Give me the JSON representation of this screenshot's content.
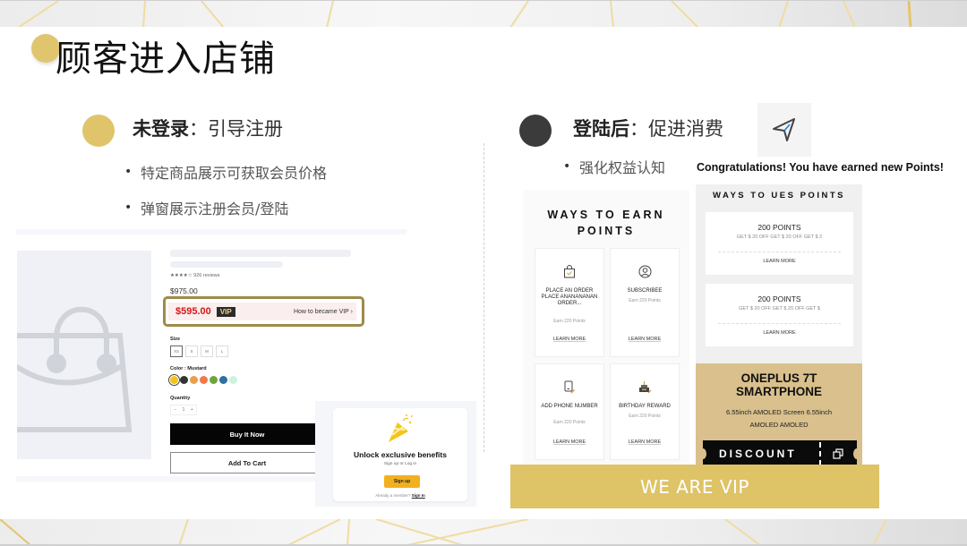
{
  "slide": {
    "title": "顾客进入店铺",
    "accent_gold": "#dfc46b",
    "accent_dark": "#3b3b3b"
  },
  "left_section": {
    "heading_bold": "未登录",
    "heading_rest": "：引导注册",
    "bullets": [
      "特定商品展示可获取会员价格",
      "弹窗展示注册会员/登陆"
    ],
    "product": {
      "image_icon": "shopping-bag-icon",
      "reviews": "★★★★☆ 926 reviews",
      "original_price": "$975.00",
      "vip_price": "$595.00",
      "vip_tag": "VIP",
      "vip_link": "How to became VIP  ›",
      "size_label": "Size",
      "sizes": [
        "XS",
        "S",
        "M",
        "L"
      ],
      "selected_size": "XS",
      "color_label": "Color : Mustard",
      "colors": [
        "#f2c31b",
        "#333333",
        "#e8a04f",
        "#f1784b",
        "#6da53a",
        "#2f6fa3",
        "#cdf2dc"
      ],
      "selected_color": "Mustard",
      "quantity_label": "Quantity",
      "quantity": "1",
      "qty_minus": "−",
      "qty_plus": "+",
      "buy_now": "Buy It Now",
      "add_to_cart": "Add To Cart"
    },
    "popup": {
      "icon": "party-popper-icon",
      "title": "Unlock exclusive benefits",
      "subtitle": "Sign up or Log in",
      "signup_button": "Sign up",
      "member_text": "Already a member? ",
      "signin_link": "Sign In"
    }
  },
  "right_section": {
    "heading_bold": "登陆后",
    "heading_rest": "：促进消费",
    "bullets": [
      "强化权益认知"
    ],
    "send_icon": "send-icon",
    "congrats": "Congratulations! You have earned new Points!",
    "earn_panel": {
      "title_line1": "WAYS TO EARN",
      "title_line2": "POINTS",
      "cards": [
        {
          "icon": "shopping-bag-icon",
          "name": "PLACE AN ORDER PLACE ANANANANAN ORDER...",
          "points": "Earn 220 Points",
          "link": "LEARN MORE"
        },
        {
          "icon": "user-circle-icon",
          "name": "SUBSCRIBEE",
          "points": "Earn 220 Points",
          "link": "LEARN MORE"
        },
        {
          "icon": "phone-edit-icon",
          "name": "ADD PHONE NUMBER",
          "points": "Earn 220 Points",
          "link": "LEARN MORE"
        },
        {
          "icon": "birthday-cake-icon",
          "name": "BIRTHDAY REWARD",
          "points": "Earn 220 Points",
          "link": "LEARN MORE"
        }
      ]
    },
    "use_panel": {
      "title": "WAYS TO UES POINTS",
      "cards": [
        {
          "points": "200 POINTS",
          "offer": "GET $ 20 OFF GET $ 20 OFF GET $ 2",
          "link": "LEARN MORE"
        },
        {
          "points": "200 POINTS",
          "offer": "GET $ 20 OFF GET $ 20 OFF GET $",
          "link": "LEARN MORE"
        }
      ]
    },
    "phone_promo": {
      "name_line1": "ONEPLUS 7T",
      "name_line2": "SMARTPHONE",
      "desc_line1": "6.55inch AMOLED Screen 6.55inch",
      "desc_line2": "AMOLED  AMOLED",
      "discount_label": "DISCOUNT",
      "copy_icon": "copy-icon"
    },
    "banner": "WE ARE VIP"
  }
}
